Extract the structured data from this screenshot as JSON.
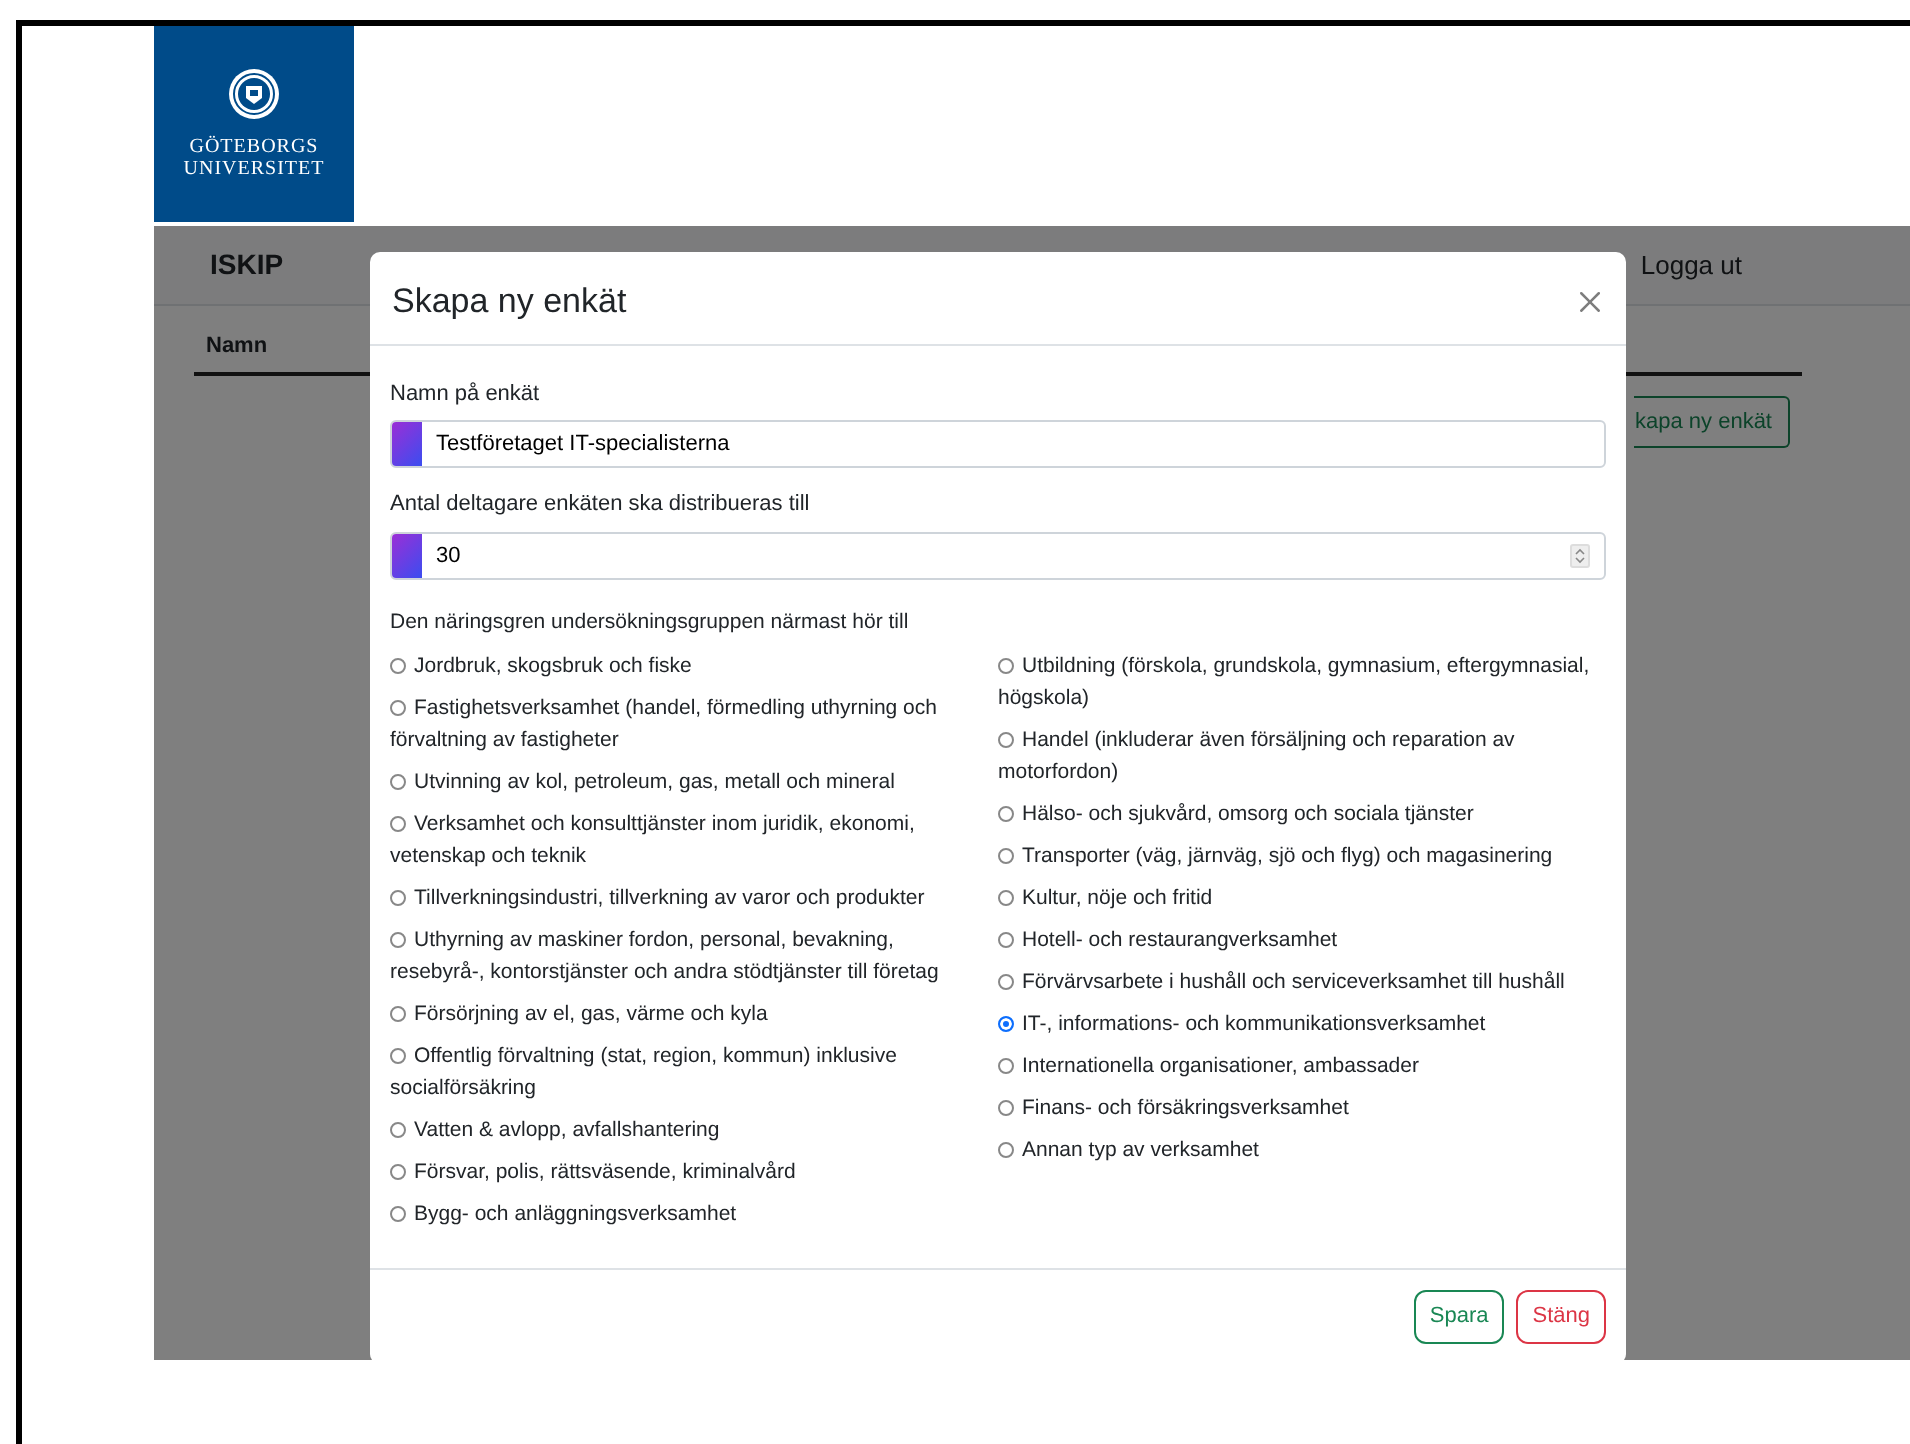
{
  "logo": {
    "lines": [
      "GÖTEBORGS",
      "UNIVERSITET"
    ]
  },
  "navbar": {
    "brand": "ISKIP",
    "link": "Logga ut"
  },
  "table": {
    "columns": [
      "Namn"
    ]
  },
  "create_button": "kapa ny enkät",
  "modal": {
    "title": "Skapa ny enkät",
    "fields": [
      {
        "label": "Namn på enkät",
        "kind": "text",
        "value": "Testföretaget IT-specialisterna"
      },
      {
        "label": "Antal deltagare enkäten ska distribueras till",
        "kind": "number",
        "value": "30"
      }
    ],
    "group_label": "Den näringsgren undersökningsgruppen närmast hör till",
    "option_columns": [
      {
        "options": [
          {
            "label": "Jordbruk, skogsbruk och fiske",
            "selected": false
          },
          {
            "label": "Fastighetsverksamhet (handel, förmedling uthyrning och förvaltning av fastigheter",
            "selected": false
          },
          {
            "label": "Utvinning av kol, petroleum, gas, metall och mineral",
            "selected": false
          },
          {
            "label": "Verksamhet och konsulttjänster inom juridik, ekonomi, vetenskap och teknik",
            "selected": false
          },
          {
            "label": "Tillverkningsindustri, tillverkning av varor och produkter",
            "selected": false
          },
          {
            "label": "Uthyrning av maskiner fordon, personal, bevakning, resebyrå-, kontorstjänster och andra stödtjänster till företag",
            "selected": false
          },
          {
            "label": "Försörjning av el, gas, värme och kyla",
            "selected": false
          },
          {
            "label": "Offentlig förvaltning (stat, region, kommun) inklusive socialförsäkring",
            "selected": false
          },
          {
            "label": "Vatten & avlopp, avfallshantering",
            "selected": false
          },
          {
            "label": "Försvar, polis, rättsväsende, kriminalvård",
            "selected": false
          },
          {
            "label": "Bygg- och anläggningsverksamhet",
            "selected": false
          }
        ]
      },
      {
        "options": [
          {
            "label": "Utbildning (förskola, grundskola, gymnasium, eftergymnasial, högskola)",
            "selected": false
          },
          {
            "label": "Handel (inkluderar även försäljning och reparation av motorfordon)",
            "selected": false
          },
          {
            "label": "Hälso- och sjukvård, omsorg och sociala tjänster",
            "selected": false
          },
          {
            "label": "Transporter (väg, järnväg, sjö och flyg) och magasinering",
            "selected": false
          },
          {
            "label": "Kultur, nöje och fritid",
            "selected": false
          },
          {
            "label": "Hotell- och restaurangverksamhet",
            "selected": false
          },
          {
            "label": "Förvärvsarbete i hushåll och serviceverksamhet till hushåll",
            "selected": false
          },
          {
            "label": "IT-, informations- och kommunikationsverksamhet",
            "selected": true
          },
          {
            "label": "Internationella organisationer, ambassader",
            "selected": false
          },
          {
            "label": "Finans- och försäkringsverksamhet",
            "selected": false
          },
          {
            "label": "Annan typ av verksamhet",
            "selected": false
          }
        ]
      }
    ],
    "buttons": [
      {
        "label": "Spara",
        "kind": "save"
      },
      {
        "label": "Stäng",
        "kind": "close"
      }
    ]
  }
}
